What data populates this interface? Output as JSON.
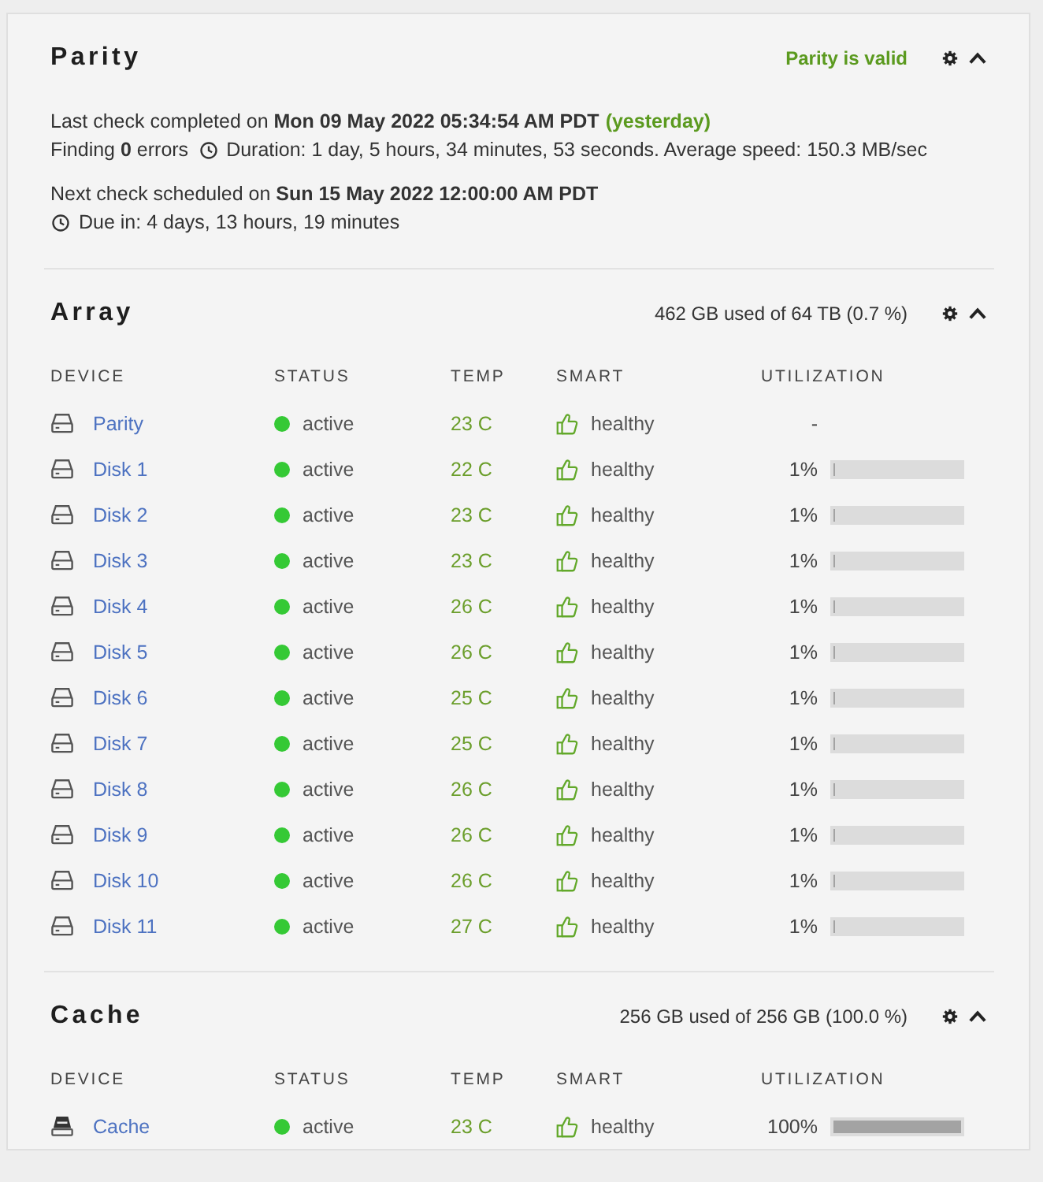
{
  "parity": {
    "title": "Parity",
    "status": "Parity is valid",
    "expanded": true,
    "last_check": "Last check completed on **Mon 09 May 2022 05:34:54 AM PDT**",
    "last_check_relative": "(yesterday)",
    "errors": "Finding **0** errors",
    "duration": "Duration: 1 day, 5 hours, 34 minutes, 53 seconds. Average speed: 150.3 MB/sec",
    "next_check": "Next check scheduled on **Sun 15 May 2022 12:00:00 AM PDT**",
    "due_in": "Due in: 4 days, 13 hours, 19 minutes"
  },
  "pools": [
    {
      "title": "Array",
      "usage": "462 GB used of 64 TB (0.7 %)",
      "expanded": true,
      "columns": [
        "DEVICE",
        "STATUS",
        "TEMP",
        "SMART",
        "UTILIZATION"
      ],
      "devices": [
        {
          "name": "Parity",
          "kind": "hdd",
          "status": "active",
          "color": "#35c935",
          "temp": "23 C",
          "smart": "healthy",
          "utilization": "-"
        },
        {
          "name": "Disk 1",
          "kind": "hdd",
          "status": "active",
          "color": "#35c935",
          "temp": "22 C",
          "smart": "healthy",
          "utilization": "1%",
          "level": 0.01
        },
        {
          "name": "Disk 2",
          "kind": "hdd",
          "status": "active",
          "color": "#35c935",
          "temp": "23 C",
          "smart": "healthy",
          "utilization": "1%",
          "level": 0.01
        },
        {
          "name": "Disk 3",
          "kind": "hdd",
          "status": "active",
          "color": "#35c935",
          "temp": "23 C",
          "smart": "healthy",
          "utilization": "1%",
          "level": 0.01
        },
        {
          "name": "Disk 4",
          "kind": "hdd",
          "status": "active",
          "color": "#35c935",
          "temp": "26 C",
          "smart": "healthy",
          "utilization": "1%",
          "level": 0.01
        },
        {
          "name": "Disk 5",
          "kind": "hdd",
          "status": "active",
          "color": "#35c935",
          "temp": "26 C",
          "smart": "healthy",
          "utilization": "1%",
          "level": 0.01
        },
        {
          "name": "Disk 6",
          "kind": "hdd",
          "status": "active",
          "color": "#35c935",
          "temp": "25 C",
          "smart": "healthy",
          "utilization": "1%",
          "level": 0.01
        },
        {
          "name": "Disk 7",
          "kind": "hdd",
          "status": "active",
          "color": "#35c935",
          "temp": "25 C",
          "smart": "healthy",
          "utilization": "1%",
          "level": 0.01
        },
        {
          "name": "Disk 8",
          "kind": "hdd",
          "status": "active",
          "color": "#35c935",
          "temp": "26 C",
          "smart": "healthy",
          "utilization": "1%",
          "level": 0.01
        },
        {
          "name": "Disk 9",
          "kind": "hdd",
          "status": "active",
          "color": "#35c935",
          "temp": "26 C",
          "smart": "healthy",
          "utilization": "1%",
          "level": 0.01
        },
        {
          "name": "Disk 10",
          "kind": "hdd",
          "status": "active",
          "color": "#35c935",
          "temp": "26 C",
          "smart": "healthy",
          "utilization": "1%",
          "level": 0.01
        },
        {
          "name": "Disk 11",
          "kind": "hdd",
          "status": "active",
          "color": "#35c935",
          "temp": "27 C",
          "smart": "healthy",
          "utilization": "1%",
          "level": 0.01
        }
      ]
    },
    {
      "title": "Cache",
      "usage": "256 GB used of 256 GB (100.0 %)",
      "expanded": true,
      "columns": [
        "DEVICE",
        "STATUS",
        "TEMP",
        "SMART",
        "UTILIZATION"
      ],
      "devices": [
        {
          "name": "Cache",
          "kind": "ssd",
          "status": "active",
          "color": "#35c935",
          "temp": "23 C",
          "smart": "healthy",
          "utilization": "100%",
          "level": 1.0
        }
      ]
    }
  ]
}
